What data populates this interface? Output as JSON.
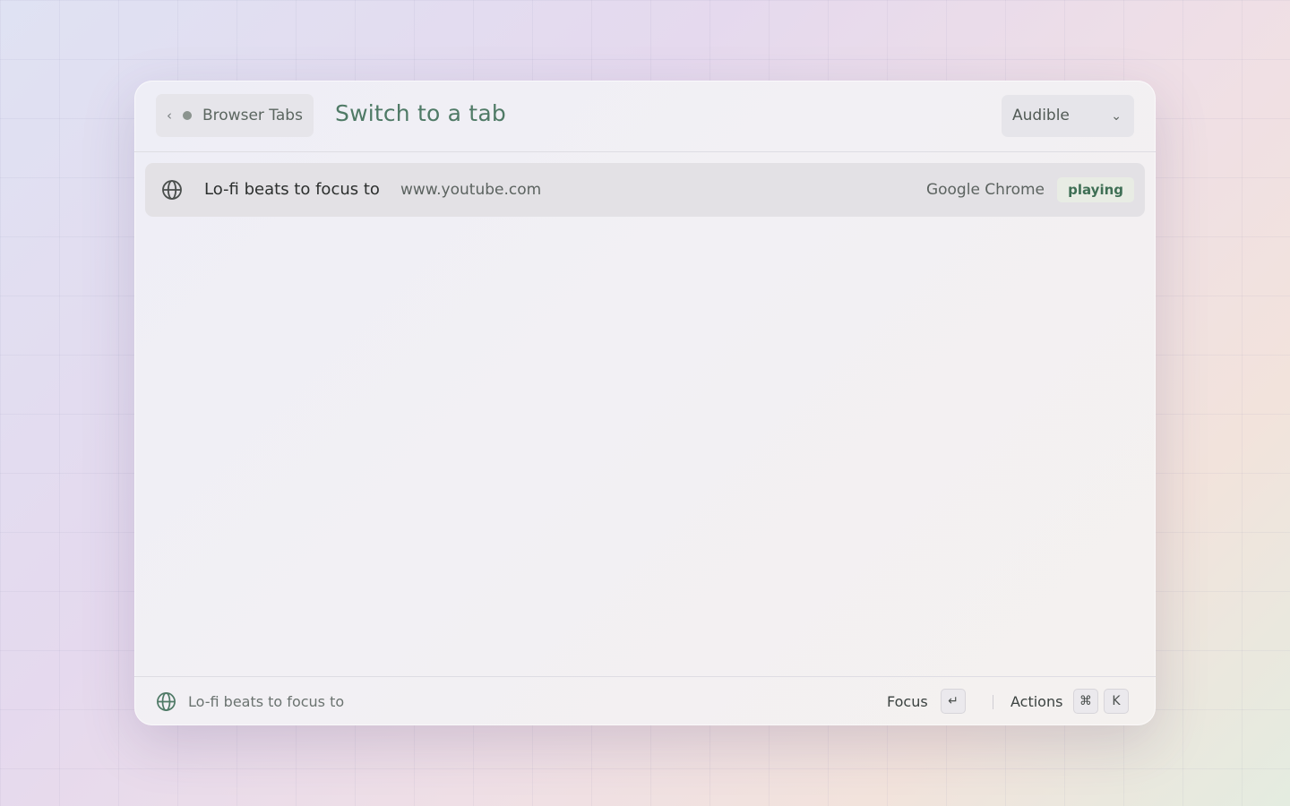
{
  "header": {
    "back_label": "Browser Tabs",
    "title": "Switch to a tab",
    "filter_value": "Audible"
  },
  "tabs": [
    {
      "title": "Lo-fi beats to focus to",
      "url": "www.youtube.com",
      "browser": "Google Chrome",
      "status": "playing",
      "icon": "globe-icon"
    }
  ],
  "footer": {
    "selected_title": "Lo-fi beats to focus to",
    "primary_action": "Focus",
    "primary_key": "↵",
    "secondary_action": "Actions",
    "secondary_key_mod": "⌘",
    "secondary_key": "K"
  },
  "colors": {
    "accent": "#4f7a66",
    "badge_text": "#3f6f55",
    "badge_bg": "#e8ece4"
  }
}
